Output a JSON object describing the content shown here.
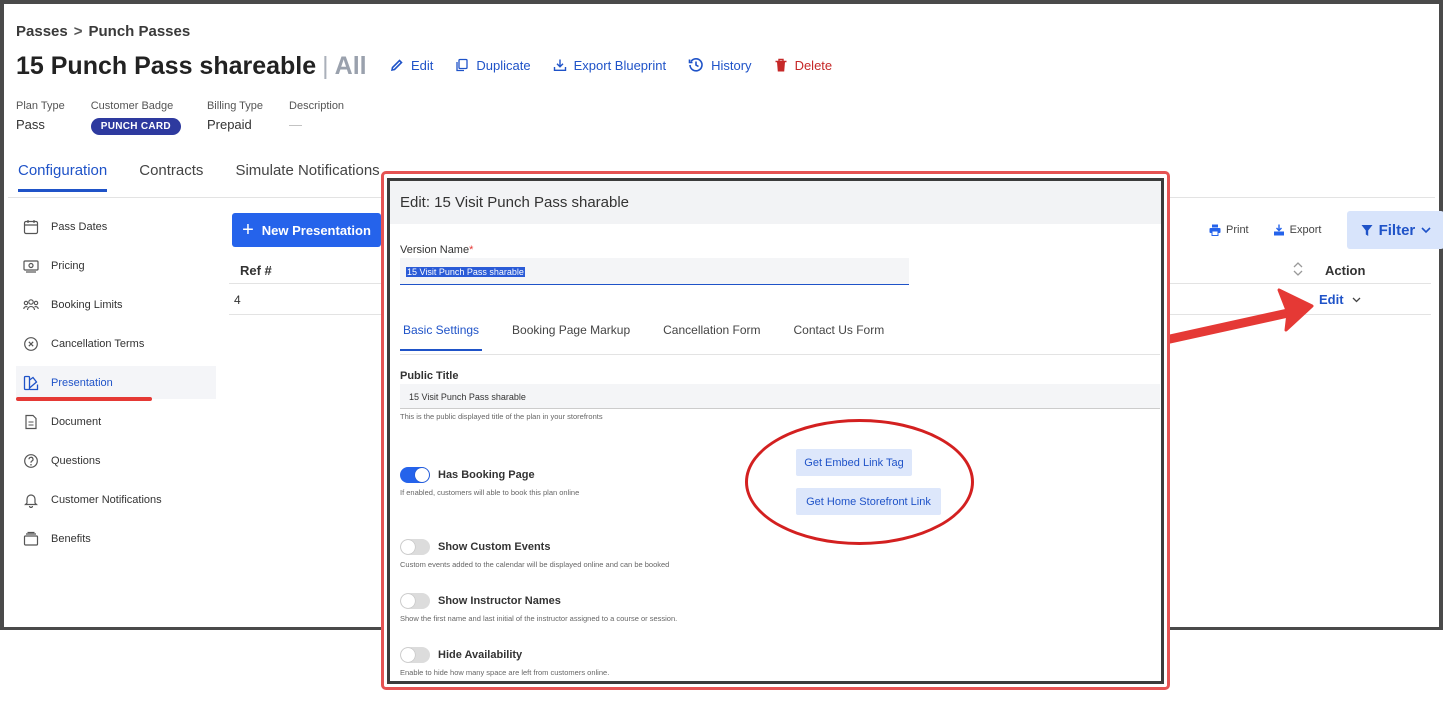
{
  "breadcrumb": {
    "root": "Passes",
    "separator": ">",
    "current": "Punch Passes"
  },
  "page": {
    "title": "15 Punch Pass shareable",
    "divider": "|",
    "filter_label": "All"
  },
  "actions": {
    "edit": "Edit",
    "duplicate": "Duplicate",
    "export_blueprint": "Export Blueprint",
    "history": "History",
    "delete": "Delete"
  },
  "meta": {
    "plan_type_label": "Plan Type",
    "plan_type_value": "Pass",
    "customer_badge_label": "Customer Badge",
    "customer_badge_value": "PUNCH CARD",
    "billing_type_label": "Billing Type",
    "billing_type_value": "Prepaid",
    "description_label": "Description",
    "description_value": "—"
  },
  "tabs": [
    "Configuration",
    "Contracts",
    "Simulate Notifications"
  ],
  "sidebar": {
    "items": [
      {
        "label": "Pass Dates",
        "icon": "calendar-icon"
      },
      {
        "label": "Pricing",
        "icon": "price-icon"
      },
      {
        "label": "Booking Limits",
        "icon": "people-icon"
      },
      {
        "label": "Cancellation Terms",
        "icon": "cancel-circle-icon"
      },
      {
        "label": "Presentation",
        "icon": "palette-icon"
      },
      {
        "label": "Document",
        "icon": "document-icon"
      },
      {
        "label": "Questions",
        "icon": "question-icon"
      },
      {
        "label": "Customer Notifications",
        "icon": "bell-icon"
      },
      {
        "label": "Benefits",
        "icon": "stack-icon"
      }
    ]
  },
  "content": {
    "new_button": "New Presentation",
    "print": "Print",
    "export": "Export",
    "filter": "Filter",
    "columns": {
      "ref": "Ref #",
      "action": "Action"
    },
    "rows": [
      {
        "ref": "4",
        "action": "Edit"
      }
    ]
  },
  "modal": {
    "title": "Edit: 15 Visit Punch Pass sharable",
    "version_name_label": "Version Name",
    "required_mark": "*",
    "version_name_value": "15 Visit Punch Pass sharable",
    "tabs": [
      "Basic Settings",
      "Booking Page Markup",
      "Cancellation Form",
      "Contact Us Form"
    ],
    "public_title_label": "Public Title",
    "public_title_value": "15 Visit Punch Pass sharable",
    "public_title_help": "This is the public displayed title of the plan in your storefronts",
    "toggles": [
      {
        "label": "Has Booking Page",
        "help": "If enabled, customers will able to book this plan online",
        "on": true
      },
      {
        "label": "Show Custom Events",
        "help": "Custom events added to the calendar will be displayed online and can be booked",
        "on": false
      },
      {
        "label": "Show Instructor Names",
        "help": "Show the first name and last initial of the instructor assigned to a course or session.",
        "on": false
      },
      {
        "label": "Hide Availability",
        "help": "Enable to hide how many space are left from customers online.",
        "on": false
      }
    ],
    "embed_link_button": "Get Embed Link Tag",
    "storefront_link_button": "Get Home Storefront Link"
  },
  "colors": {
    "accent": "#2563eb",
    "link": "#1f53c8",
    "danger": "#c62828",
    "annotation": "#e53935",
    "badge": "#2e3a9f"
  }
}
